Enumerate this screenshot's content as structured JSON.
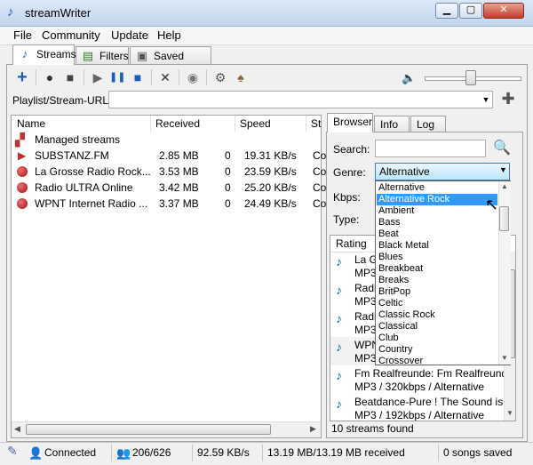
{
  "app": {
    "title": "streamWriter"
  },
  "menu": [
    "File",
    "Community",
    "Update",
    "Help"
  ],
  "tabs": [
    {
      "label": "Streams",
      "icon": "music-note-icon"
    },
    {
      "label": "Filters",
      "icon": "filter-icon"
    },
    {
      "label": "Saved songs",
      "icon": "saved-songs-icon"
    }
  ],
  "toolbar": {
    "add": "+",
    "record": "●",
    "stop_record": "■",
    "play": "▶",
    "pause": "❚❚",
    "stop": "■",
    "remove": "✕",
    "url_label": "Playlist/Stream-URL:",
    "url_value": "",
    "url_add": "✚"
  },
  "list": {
    "headers": {
      "name": "Name",
      "received": "Received",
      "speed": "Speed",
      "status": "St"
    },
    "rows": [
      {
        "name": "Managed streams",
        "received": "",
        "count": "",
        "speed": "",
        "status": ""
      },
      {
        "name": "SUBSTANZ.FM",
        "received": "2.85 MB",
        "count": "0",
        "speed": "19.31 KB/s",
        "status": "Co"
      },
      {
        "name": "La Grosse Radio Rock...",
        "received": "3.53 MB",
        "count": "0",
        "speed": "23.59 KB/s",
        "status": "Co"
      },
      {
        "name": "Radio ULTRA Online",
        "received": "3.42 MB",
        "count": "0",
        "speed": "25.20 KB/s",
        "status": "Co"
      },
      {
        "name": "WPNT Internet Radio ...",
        "received": "3.37 MB",
        "count": "0",
        "speed": "24.49 KB/s",
        "status": "Co"
      }
    ]
  },
  "browser": {
    "tabs": [
      "Browser",
      "Info",
      "Log"
    ],
    "search_label": "Search:",
    "genre_label": "Genre:",
    "genre_value": "Alternative",
    "kbps_label": "Kbps:",
    "type_label": "Type:",
    "rating_header": "Rating",
    "results": [
      {
        "name": "La Grosse Radio Rock",
        "detail": "MP3 / 192kbps / Alternative"
      },
      {
        "name": "Radio ULTRA Online",
        "detail": "MP3 / 128kbps / Alternative"
      },
      {
        "name": "Radio Paradise",
        "detail": "MP3 / 128kbps / Alternative"
      },
      {
        "name": "WPNT Internet Radio",
        "detail": "MP3 / 128kbps / Alternative"
      },
      {
        "name": "Fm Realfreunde: Fm Realfreunde",
        "detail": "MP3 / 320kbps / Alternative"
      },
      {
        "name": "Beatdance-Pure ! The Sound is...",
        "detail": "MP3 / 192kbps / Alternative"
      }
    ],
    "found": "10 streams found",
    "genres": [
      "Alternative",
      "Alternative Rock",
      "Ambient",
      "Bass",
      "Beat",
      "Black Metal",
      "Blues",
      "Breakbeat",
      "Breaks",
      "BritPop",
      "Celtic",
      "Classic Rock",
      "Classical",
      "Club",
      "Country",
      "Crossover"
    ],
    "selected_genre_index": 1
  },
  "status": {
    "connection": "Connected",
    "clients": "206/626",
    "speed": "92.59 KB/s",
    "received": "13.19 MB/13.19 MB received",
    "saved": "0 songs saved"
  },
  "colors": {
    "selection": "#3399ff",
    "record_dot": "#c0392b",
    "accent": "#1a5dbf"
  }
}
